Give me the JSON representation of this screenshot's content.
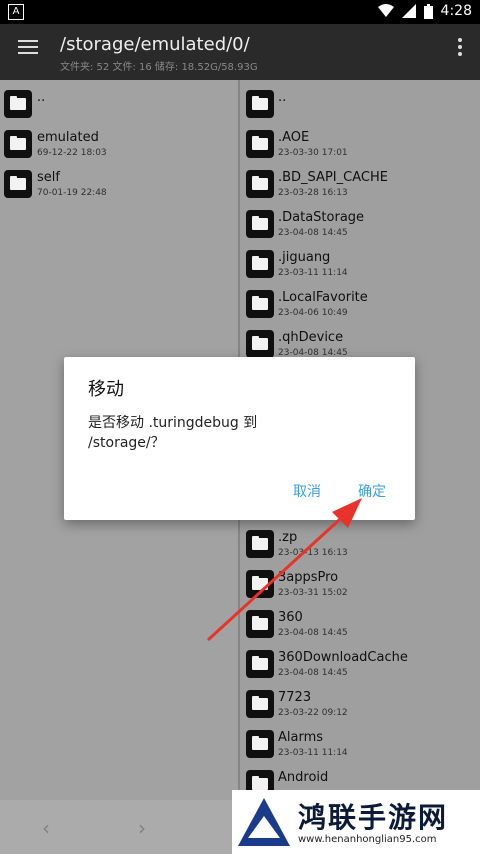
{
  "status_bar": {
    "time": "4:28",
    "app_icon": "A"
  },
  "toolbar": {
    "path": "/storage/emulated/0/",
    "info": "文件夹: 52  文件: 16  储存: 18.52G/58.93G"
  },
  "left_pane": [
    {
      "name": "..",
      "date": ""
    },
    {
      "name": "emulated",
      "date": "69-12-22 18:03"
    },
    {
      "name": "self",
      "date": "70-01-19 22:48"
    }
  ],
  "right_pane": [
    {
      "name": "..",
      "date": ""
    },
    {
      "name": ".AOE",
      "date": "23-03-30 17:01"
    },
    {
      "name": ".BD_SAPI_CACHE",
      "date": "23-03-28 16:13"
    },
    {
      "name": ".DataStorage",
      "date": "23-04-08 14:45"
    },
    {
      "name": ".jiguang",
      "date": "23-03-11 11:14"
    },
    {
      "name": ".LocalFavorite",
      "date": "23-04-06 10:49"
    },
    {
      "name": ".qhDevice",
      "date": "23-04-08 14:45"
    },
    {
      "name": "",
      "date": ""
    },
    {
      "name": "",
      "date": ""
    },
    {
      "name": "",
      "date": ""
    },
    {
      "name": "",
      "date": ""
    },
    {
      "name": ".zp",
      "date": "23-03-13 16:13"
    },
    {
      "name": "3appsPro",
      "date": "23-03-31 15:02"
    },
    {
      "name": "360",
      "date": "23-04-08 14:45"
    },
    {
      "name": "360DownloadCache",
      "date": "23-04-08 14:45"
    },
    {
      "name": "7723",
      "date": "23-03-22 09:12"
    },
    {
      "name": "Alarms",
      "date": "23-03-11 11:14"
    },
    {
      "name": "Android",
      "date": ""
    }
  ],
  "dialog": {
    "title": "移动",
    "message": "是否移动 .turingdebug 到 /storage/？",
    "cancel": "取消",
    "ok": "确定"
  },
  "watermark": {
    "title": "鸿联手游网",
    "url": "www.henanhonglian95.com"
  },
  "colors": {
    "accent": "#3b9fe3",
    "arrow": "#e8322a"
  }
}
